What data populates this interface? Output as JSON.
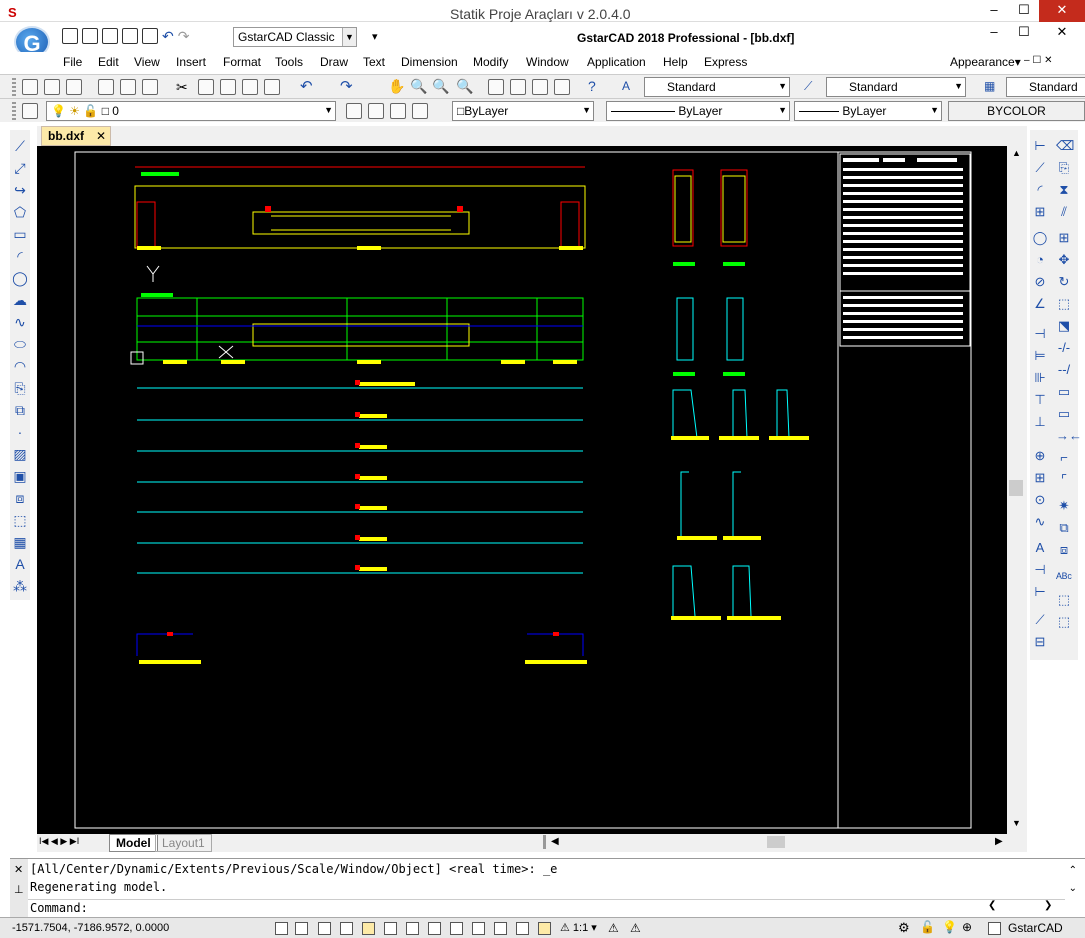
{
  "window": {
    "outer_title": "Statik Proje Araçları v 2.0.4.0",
    "app_title": "GstarCAD 2018 Professional - [bb.dxf]",
    "logo_letter": "G"
  },
  "workspace": {
    "value": "GstarCAD Classic"
  },
  "menu": [
    "File",
    "Edit",
    "View",
    "Insert",
    "Format",
    "Tools",
    "Draw",
    "Text",
    "Dimension",
    "Modify",
    "Window",
    "Application",
    "Help",
    "Express"
  ],
  "appearance": "Appearance",
  "styles": {
    "text_style": "Standard",
    "dim_style": "Standard",
    "table_style": "Standard"
  },
  "layer": {
    "name": "0",
    "color": "ByLayer",
    "linetype": "ByLayer",
    "lineweight": "ByLayer",
    "plotstyle": "BYCOLOR"
  },
  "file_tab": "bb.dxf",
  "layout_tabs": {
    "model": "Model",
    "layout1": "Layout1"
  },
  "command": {
    "line1": "[All/Center/Dynamic/Extents/Previous/Scale/Window/Object] <real time>: _e",
    "line2": "Regenerating model.",
    "prompt": "Command:"
  },
  "status": {
    "coords": "-1571.7504, -7186.9572, 0.0000",
    "scale": "1:1",
    "product": "GstarCAD"
  },
  "colors": {
    "canvas": "#000000",
    "cyan": "#00ffff",
    "yellow": "#ffff00",
    "red": "#ff0000",
    "green": "#00ff00",
    "blue": "#0000ff"
  }
}
